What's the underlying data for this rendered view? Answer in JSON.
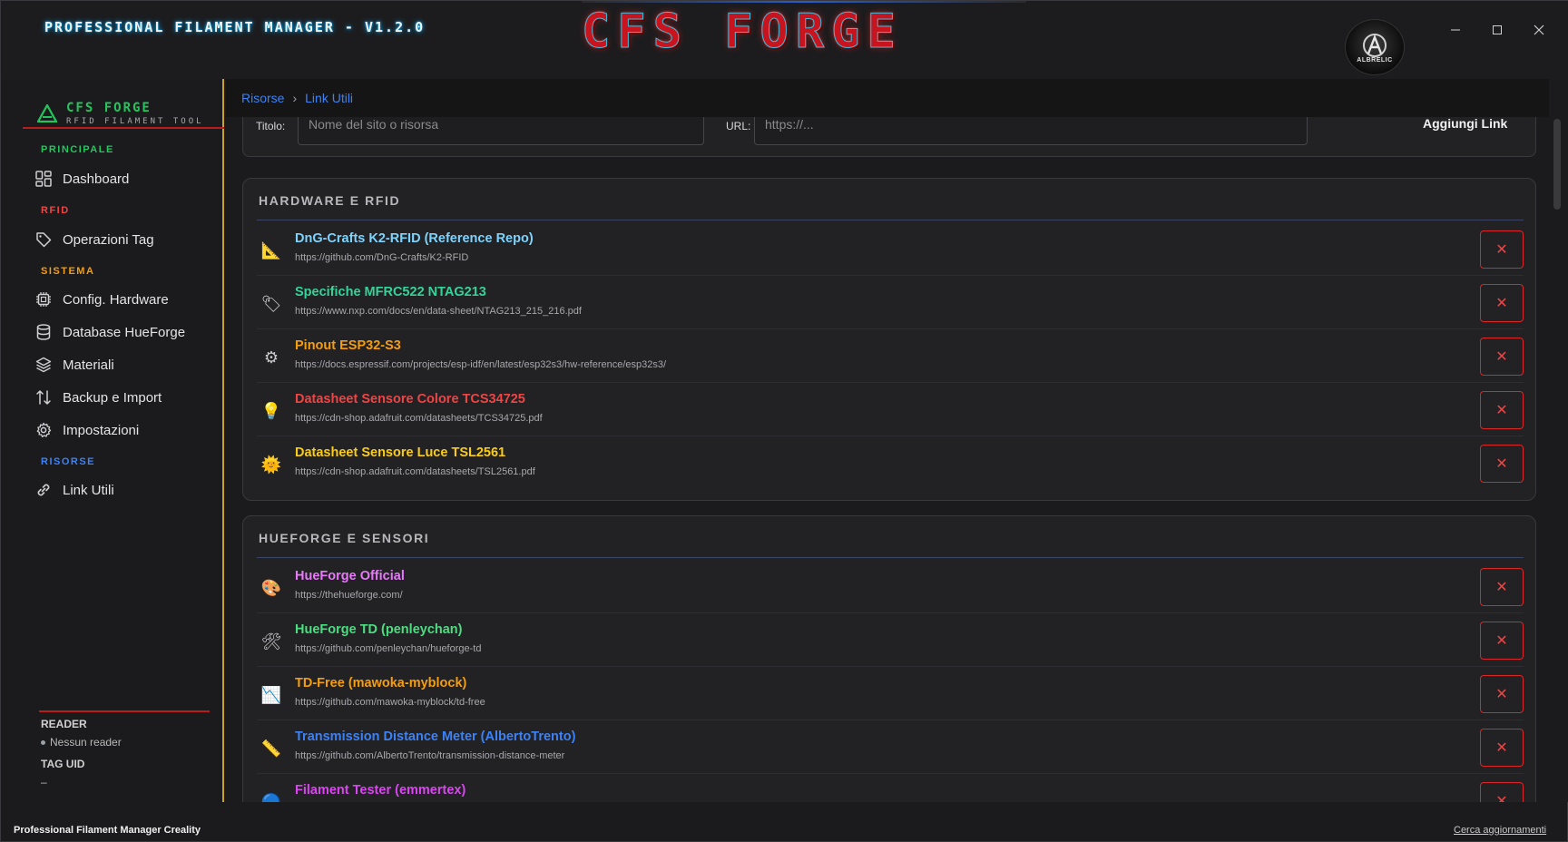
{
  "window": {
    "app_title": "PROFESSIONAL FILAMENT MANAGER - V1.2.0",
    "brand": "CFS FORGE",
    "avatar_label": "ALBRELIC"
  },
  "sidebar": {
    "logo_title": "CFS FORGE",
    "logo_subtitle": "RFID FILAMENT TOOL",
    "sections": [
      {
        "label": "PRINCIPALE",
        "color": "#22c55e"
      },
      {
        "label": "RFID",
        "color": "#ef4444"
      },
      {
        "label": "SISTEMA",
        "color": "#f59e0b"
      },
      {
        "label": "RISORSE",
        "color": "#3b82f6"
      }
    ],
    "items": [
      {
        "label": "Dashboard",
        "icon": "dashboard-icon"
      },
      {
        "label": "Operazioni Tag",
        "icon": "tag-icon"
      },
      {
        "label": "Config. Hardware",
        "icon": "chip-icon"
      },
      {
        "label": "Database HueForge",
        "icon": "database-icon"
      },
      {
        "label": "Materiali",
        "icon": "layers-icon"
      },
      {
        "label": "Backup e Import",
        "icon": "swap-arrows-icon"
      },
      {
        "label": "Impostazioni",
        "icon": "gear-icon"
      },
      {
        "label": "Link Utili",
        "icon": "link-icon"
      }
    ],
    "reader_label": "READER",
    "reader_value": "Nessun reader",
    "tag_uid_label": "TAG UID",
    "tag_uid_value": "–"
  },
  "breadcrumb": {
    "parent": "Risorse",
    "separator": "›",
    "current": "Link Utili"
  },
  "form": {
    "title_label": "Titolo:",
    "title_placeholder": "Nome del sito o risorsa",
    "url_label": "URL:",
    "url_placeholder": "https://...",
    "add_button": "Aggiungi Link"
  },
  "cards": [
    {
      "title": "HARDWARE E RFID",
      "links": [
        {
          "title": "DnG-Crafts K2-RFID (Reference Repo)",
          "url": "https://github.com/DnG-Crafts/K2-RFID",
          "color": "#7dd3fc",
          "icon": "triangle-ruler-icon",
          "glyph": "📐"
        },
        {
          "title": "Specifiche MFRC522 NTAG213",
          "url": "https://www.nxp.com/docs/en/data-sheet/NTAG213_215_216.pdf",
          "color": "#34d399",
          "icon": "label-tag-icon",
          "glyph": "🏷"
        },
        {
          "title": "Pinout ESP32-S3",
          "url": "https://docs.espressif.com/projects/esp-idf/en/latest/esp32s3/hw-reference/esp32s3/",
          "color": "#f59e0b",
          "icon": "gear-icon",
          "glyph": "⚙"
        },
        {
          "title": "Datasheet Sensore Colore TCS34725",
          "url": "https://cdn-shop.adafruit.com/datasheets/TCS34725.pdf",
          "color": "#ef4444",
          "icon": "light-bulb-icon",
          "glyph": "💡"
        },
        {
          "title": "Datasheet Sensore Luce TSL2561",
          "url": "https://cdn-shop.adafruit.com/datasheets/TSL2561.pdf",
          "color": "#facc15",
          "icon": "sun-icon",
          "glyph": "🌞"
        }
      ]
    },
    {
      "title": "HUEFORGE E SENSORI",
      "links": [
        {
          "title": "HueForge Official",
          "url": "https://thehueforge.com/",
          "color": "#e879f9",
          "icon": "palette-icon",
          "glyph": "🎨"
        },
        {
          "title": "HueForge TD (penleychan)",
          "url": "https://github.com/penleychan/hueforge-td",
          "color": "#4ade80",
          "icon": "tools-icon",
          "glyph": "🛠"
        },
        {
          "title": "TD-Free (mawoka-myblock)",
          "url": "https://github.com/mawoka-myblock/td-free",
          "color": "#f59e0b",
          "icon": "chart-down-icon",
          "glyph": "📉"
        },
        {
          "title": "Transmission Distance Meter (AlbertoTrento)",
          "url": "https://github.com/AlbertoTrento/transmission-distance-meter",
          "color": "#3b82f6",
          "icon": "ruler-icon",
          "glyph": "📏"
        },
        {
          "title": "Filament Tester (emmertex)",
          "url": "",
          "color": "#d946ef",
          "icon": "globe-icon",
          "glyph": "🔵"
        }
      ]
    }
  ],
  "delete_glyph": "✕",
  "footer": {
    "left": "Professional Filament Manager Creality",
    "right": "Cerca aggiornamenti"
  }
}
